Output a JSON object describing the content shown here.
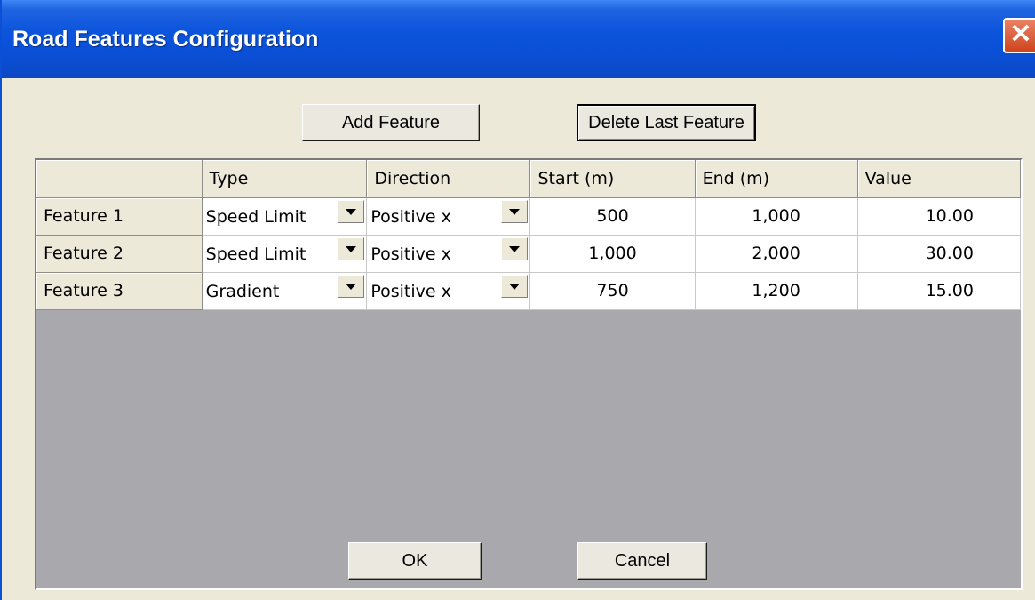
{
  "window": {
    "title": "Road Features Configuration",
    "close_symbol": "✕"
  },
  "toolbar": {
    "add_label": "Add Feature",
    "delete_label": "Delete Last Feature"
  },
  "table": {
    "headers": [
      "",
      "Type",
      "Direction",
      "Start (m)",
      "End (m)",
      "Value"
    ],
    "rows": [
      {
        "name": "Feature 1",
        "type": "Speed Limit",
        "direction": "Positive x",
        "start": "500",
        "end": "1,000",
        "value": "10.00"
      },
      {
        "name": "Feature 2",
        "type": "Speed Limit",
        "direction": "Positive x",
        "start": "1,000",
        "end": "2,000",
        "value": "30.00"
      },
      {
        "name": "Feature 3",
        "type": "Gradient",
        "direction": "Positive x",
        "start": "750",
        "end": "1,200",
        "value": "15.00"
      }
    ]
  },
  "footer": {
    "ok_label": "OK",
    "cancel_label": "Cancel"
  },
  "icons": {
    "dropdown": "chevron-down-icon",
    "close": "close-icon"
  },
  "colors": {
    "titlebar": "#0a4fd6",
    "dialog_bg": "#ece9d8",
    "grid_empty": "#a9a8ad",
    "close_button": "#d0441d"
  }
}
